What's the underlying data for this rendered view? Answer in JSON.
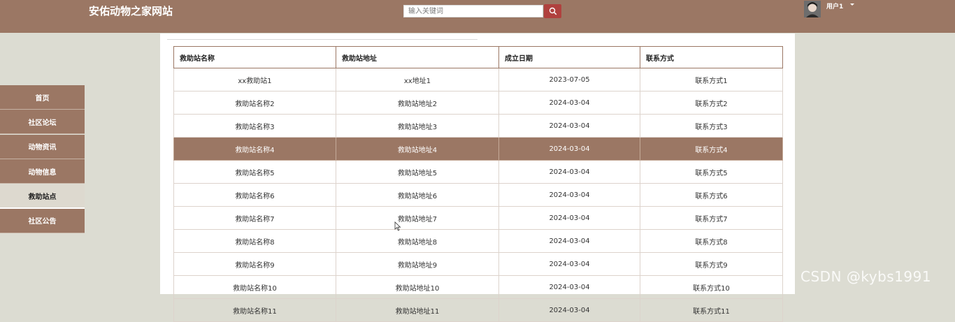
{
  "header": {
    "site_title": "安佑动物之家网站",
    "search_placeholder": "输入关键词",
    "username": "用户1"
  },
  "icons": {
    "search": "search-icon",
    "user": "avatar",
    "caret": "caret-down-icon"
  },
  "colors": {
    "brand": "#9b7764",
    "search_button": "#b0413e",
    "page_bg": "#dcdcd2"
  },
  "sidebar": {
    "items": [
      {
        "label": "首页"
      },
      {
        "label": "社区论坛"
      },
      {
        "label": "动物资讯"
      },
      {
        "label": "动物信息"
      },
      {
        "label": "救助站点",
        "active": true
      },
      {
        "label": "社区公告"
      }
    ]
  },
  "table": {
    "headers": [
      "救助站名称",
      "救助站地址",
      "成立日期",
      "联系方式"
    ],
    "rows": [
      [
        "xx救助站1",
        "xx地址1",
        "2023-07-05",
        "联系方式1"
      ],
      [
        "救助站名称2",
        "救助站地址2",
        "2024-03-04",
        "联系方式2"
      ],
      [
        "救助站名称3",
        "救助站地址3",
        "2024-03-04",
        "联系方式3"
      ],
      [
        "救助站名称4",
        "救助站地址4",
        "2024-03-04",
        "联系方式4"
      ],
      [
        "救助站名称5",
        "救助站地址5",
        "2024-03-04",
        "联系方式5"
      ],
      [
        "救助站名称6",
        "救助站地址6",
        "2024-03-04",
        "联系方式6"
      ],
      [
        "救助站名称7",
        "救助站地址7",
        "2024-03-04",
        "联系方式7"
      ],
      [
        "救助站名称8",
        "救助站地址8",
        "2024-03-04",
        "联系方式8"
      ],
      [
        "救助站名称9",
        "救助站地址9",
        "2024-03-04",
        "联系方式9"
      ],
      [
        "救助站名称10",
        "救助站地址10",
        "2024-03-04",
        "联系方式10"
      ],
      [
        "救助站名称11",
        "救助站地址11",
        "2024-03-04",
        "联系方式11"
      ]
    ],
    "highlighted_row": 3
  },
  "watermark": "CSDN @kybs1991"
}
